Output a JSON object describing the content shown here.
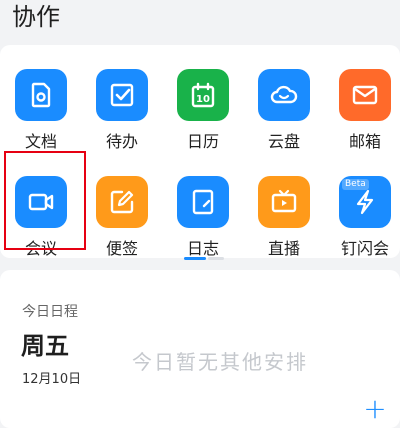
{
  "header": {
    "title": "协作"
  },
  "apps": [
    {
      "label": "文档",
      "color": "#1a8cff",
      "icon": "document-icon"
    },
    {
      "label": "待办",
      "color": "#1a8cff",
      "icon": "todo-icon"
    },
    {
      "label": "日历",
      "color": "#19b24a",
      "icon": "calendar-icon",
      "icon_text": "10"
    },
    {
      "label": "云盘",
      "color": "#1a8cff",
      "icon": "cloud-drive-icon"
    },
    {
      "label": "邮箱",
      "color": "#ff6a2a",
      "icon": "mail-icon"
    },
    {
      "label": "会议",
      "color": "#1a8cff",
      "icon": "video-camera-icon"
    },
    {
      "label": "便签",
      "color": "#ff9a1a",
      "icon": "note-icon"
    },
    {
      "label": "日志",
      "color": "#1a8cff",
      "icon": "journal-icon"
    },
    {
      "label": "直播",
      "color": "#ff9a1a",
      "icon": "live-tv-icon"
    },
    {
      "label": "钉闪会",
      "color": "#1a8cff",
      "icon": "flash-meeting-icon",
      "badge": "Beta"
    }
  ],
  "pager": {
    "active_color": "#1a8cff",
    "inactive_color": "#dcdfe4",
    "pages": 2,
    "active_page": 1
  },
  "highlight_color": "#e60012",
  "schedule": {
    "label": "今日日程",
    "weekday": "周五",
    "date": "12月10日",
    "empty_text": "今日暂无其他安排",
    "add_symbol": "+"
  }
}
